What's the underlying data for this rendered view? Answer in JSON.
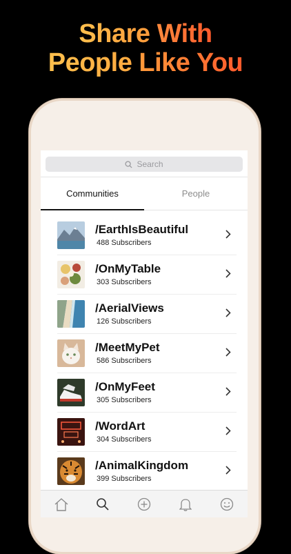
{
  "headline": {
    "line1_a": "Share",
    "line1_b": "With",
    "line2_a": "People",
    "line2_b": "Like You"
  },
  "search": {
    "placeholder": "Search"
  },
  "tabs": [
    {
      "label": "Communities",
      "active": true
    },
    {
      "label": "People",
      "active": false
    }
  ],
  "communities": [
    {
      "name": "/EarthIsBeautiful",
      "subscribers": "488 Subscribers",
      "thumb_icon": "mountain-lake-thumbnail"
    },
    {
      "name": "/OnMyTable",
      "subscribers": "303 Subscribers",
      "thumb_icon": "food-thumbnail"
    },
    {
      "name": "/AerialViews",
      "subscribers": "126 Subscribers",
      "thumb_icon": "coastline-thumbnail"
    },
    {
      "name": "/MeetMyPet",
      "subscribers": "586 Subscribers",
      "thumb_icon": "cat-thumbnail"
    },
    {
      "name": "/OnMyFeet",
      "subscribers": "305 Subscribers",
      "thumb_icon": "sneakers-thumbnail"
    },
    {
      "name": "/WordArt",
      "subscribers": "304 Subscribers",
      "thumb_icon": "neon-sign-thumbnail"
    },
    {
      "name": "/AnimalKingdom",
      "subscribers": "399 Subscribers",
      "thumb_icon": "tiger-thumbnail"
    }
  ],
  "tabbar": [
    "home-icon",
    "search-icon",
    "add-icon",
    "bell-icon",
    "smiley-icon"
  ],
  "colors": {
    "accent_orange": "#ff7a35",
    "accent_yellow": "#ffc04d",
    "background": "#000000"
  }
}
